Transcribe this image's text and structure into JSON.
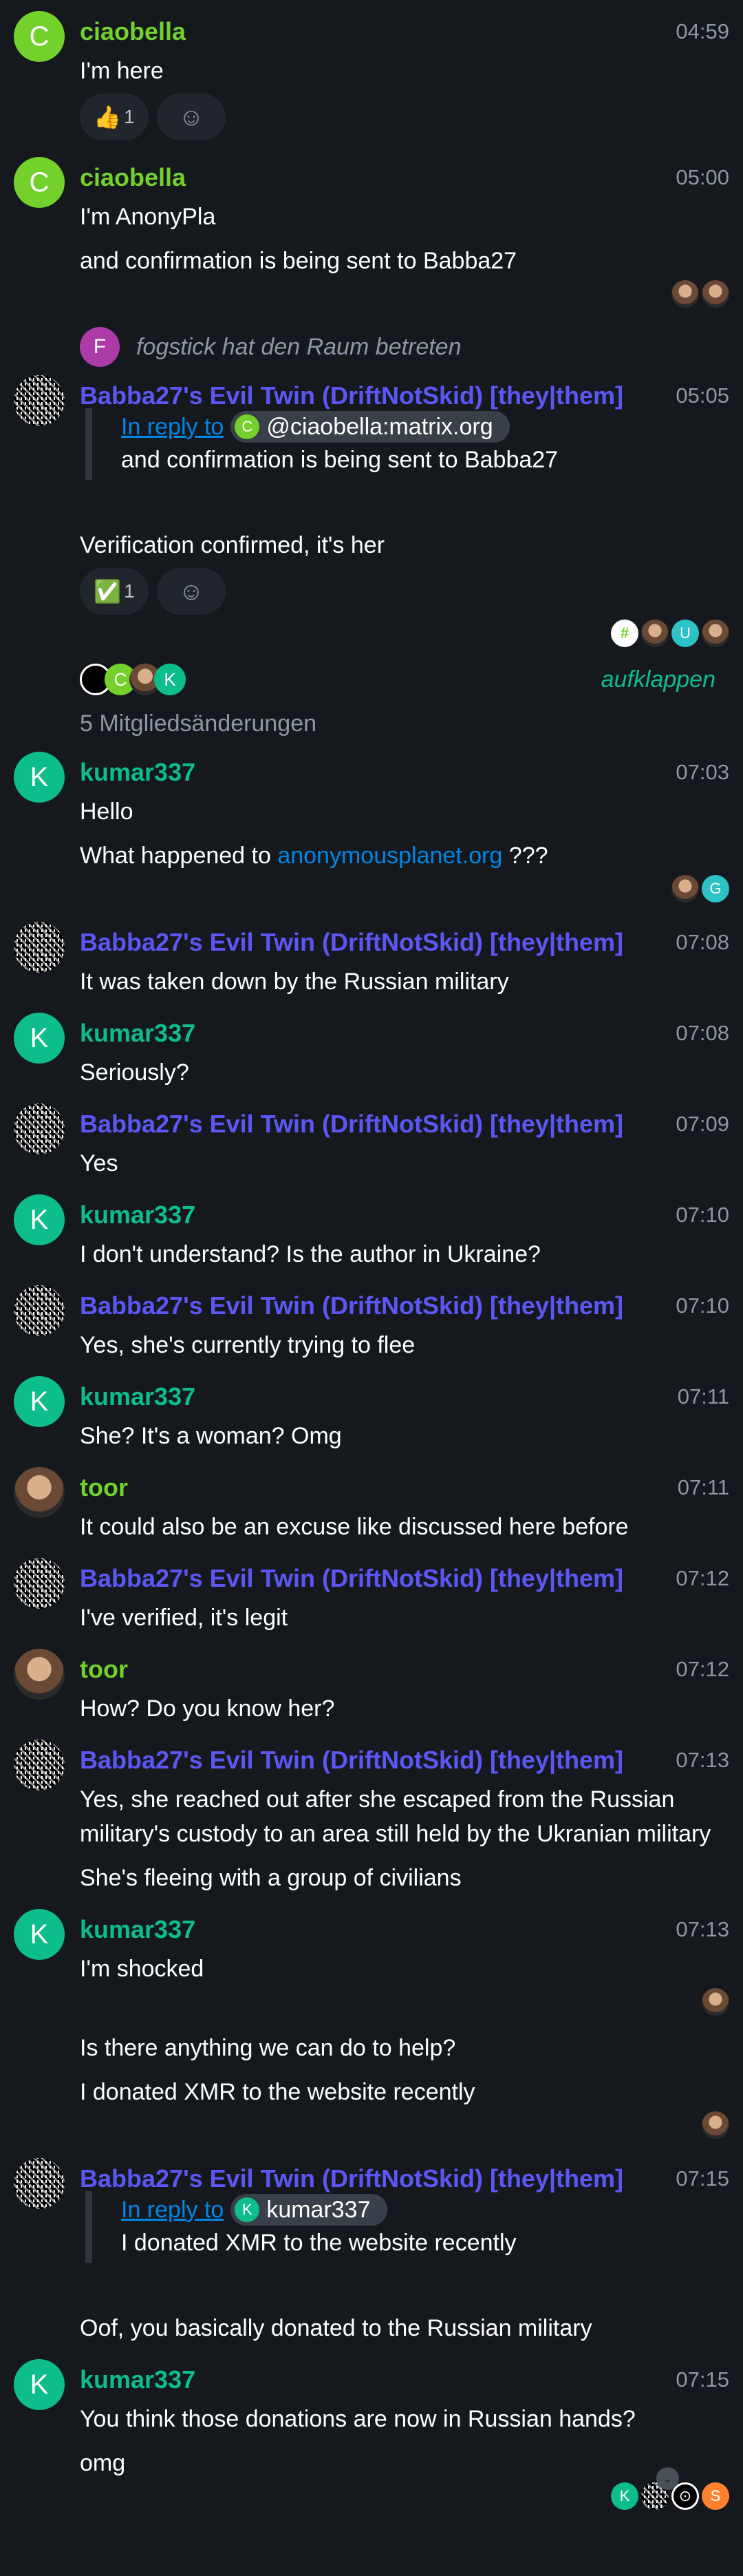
{
  "colors": {
    "ciaobella": "#74d12c",
    "kumar": "#0dbd8b",
    "babba": "#5c56f5",
    "toor": "#74d12c",
    "link": "#0086e6",
    "fogstick": "#ac3ba8",
    "teal": "#2dc2c5",
    "orange": "#ff812d"
  },
  "timeline": [
    {
      "type": "msg",
      "sender": "ciaobella",
      "name_color": "#74d12c",
      "avatar": {
        "kind": "letter",
        "letter": "C",
        "color": "#74d12c"
      },
      "time": "04:59",
      "body": [
        {
          "type": "text",
          "text": "I'm here"
        },
        {
          "type": "reactions",
          "items": [
            {
              "emoji": "👍",
              "count": "1"
            }
          ],
          "add_icon": "add-reaction-icon"
        }
      ]
    },
    {
      "type": "msg",
      "sender": "ciaobella",
      "name_color": "#74d12c",
      "avatar": {
        "kind": "letter",
        "letter": "C",
        "color": "#74d12c"
      },
      "time": "05:00",
      "body": [
        {
          "type": "text",
          "text": "I'm AnonyPla"
        },
        {
          "type": "text",
          "text": "and confirmation is being sent to Babba27"
        },
        {
          "type": "receipts",
          "items": [
            {
              "kind": "photo"
            },
            {
              "kind": "photo"
            }
          ]
        }
      ]
    },
    {
      "type": "event",
      "letter": "F",
      "color": "#ac3ba8",
      "text": "fogstick hat den Raum betreten"
    },
    {
      "type": "msg",
      "sender": "Babba27's Evil Twin (DriftNotSkid) [they|them]",
      "name_color": "#5c56f5",
      "avatar": {
        "kind": "qr"
      },
      "time": "05:05",
      "reply": {
        "label": "In reply to",
        "user": "@ciaobella:matrix.org",
        "user_letter": "C",
        "user_color": "#74d12c",
        "text": "and confirmation is being sent to Babba27"
      },
      "body": [
        {
          "type": "text",
          "text": "Verification confirmed, it's her"
        },
        {
          "type": "reactions",
          "items": [
            {
              "emoji": "✅",
              "count": "1"
            }
          ],
          "add_icon": "add-reaction-icon"
        },
        {
          "type": "receipts",
          "items": [
            {
              "kind": "letter",
              "letter": "#",
              "color": "#ffffff"
            },
            {
              "kind": "photo"
            },
            {
              "kind": "letter",
              "letter": "U",
              "color": "#2dc2c5"
            },
            {
              "kind": "photo"
            }
          ]
        }
      ]
    },
    {
      "type": "summary",
      "avatars": [
        {
          "kind": "letter",
          "letter": "",
          "color": "#000000"
        },
        {
          "kind": "letter",
          "letter": "C",
          "color": "#74d12c"
        },
        {
          "kind": "photo"
        },
        {
          "kind": "letter",
          "letter": "K",
          "color": "#0dbd8b"
        }
      ],
      "expand": "aufklappen",
      "text": "5 Mitgliedsänderungen"
    },
    {
      "type": "msg",
      "sender": "kumar337",
      "name_color": "#0dbd8b",
      "avatar": {
        "kind": "letter",
        "letter": "K",
        "color": "#0dbd8b"
      },
      "time": "07:03",
      "body": [
        {
          "type": "text",
          "text": "Hello"
        },
        {
          "type": "link",
          "before": "What happened to ",
          "link": "anonymousplanet.org",
          "after": " ???"
        },
        {
          "type": "receipts",
          "items": [
            {
              "kind": "photo"
            },
            {
              "kind": "letter",
              "letter": "G",
              "color": "#2dc2c5"
            }
          ]
        }
      ]
    },
    {
      "type": "msg",
      "sender": "Babba27's Evil Twin (DriftNotSkid) [they|them]",
      "name_color": "#5c56f5",
      "avatar": {
        "kind": "qr"
      },
      "time": "07:08",
      "body": [
        {
          "type": "text",
          "text": "It was taken down by the Russian military"
        }
      ]
    },
    {
      "type": "msg",
      "sender": "kumar337",
      "name_color": "#0dbd8b",
      "avatar": {
        "kind": "letter",
        "letter": "K",
        "color": "#0dbd8b"
      },
      "time": "07:08",
      "body": [
        {
          "type": "text",
          "text": "Seriously?"
        }
      ]
    },
    {
      "type": "msg",
      "sender": "Babba27's Evil Twin (DriftNotSkid) [they|them]",
      "name_color": "#5c56f5",
      "avatar": {
        "kind": "qr"
      },
      "time": "07:09",
      "body": [
        {
          "type": "text",
          "text": "Yes"
        }
      ]
    },
    {
      "type": "msg",
      "sender": "kumar337",
      "name_color": "#0dbd8b",
      "avatar": {
        "kind": "letter",
        "letter": "K",
        "color": "#0dbd8b"
      },
      "time": "07:10",
      "body": [
        {
          "type": "text",
          "text": "I don't understand? Is the author in Ukraine?"
        }
      ]
    },
    {
      "type": "msg",
      "sender": "Babba27's Evil Twin (DriftNotSkid) [they|them]",
      "name_color": "#5c56f5",
      "avatar": {
        "kind": "qr"
      },
      "time": "07:10",
      "body": [
        {
          "type": "text",
          "text": "Yes, she's currently trying to flee"
        }
      ]
    },
    {
      "type": "msg",
      "sender": "kumar337",
      "name_color": "#0dbd8b",
      "avatar": {
        "kind": "letter",
        "letter": "K",
        "color": "#0dbd8b"
      },
      "time": "07:11",
      "body": [
        {
          "type": "text",
          "text": "She? It's a woman? Omg"
        }
      ]
    },
    {
      "type": "msg",
      "sender": "toor",
      "name_color": "#74d12c",
      "avatar": {
        "kind": "photo"
      },
      "time": "07:11",
      "body": [
        {
          "type": "text",
          "text": "It could also be an excuse like discussed here before"
        }
      ]
    },
    {
      "type": "msg",
      "sender": "Babba27's Evil Twin (DriftNotSkid) [they|them]",
      "name_color": "#5c56f5",
      "avatar": {
        "kind": "qr"
      },
      "time": "07:12",
      "body": [
        {
          "type": "text",
          "text": "I've verified, it's legit"
        }
      ]
    },
    {
      "type": "msg",
      "sender": "toor",
      "name_color": "#74d12c",
      "avatar": {
        "kind": "photo"
      },
      "time": "07:12",
      "body": [
        {
          "type": "text",
          "text": "How? Do you know her?"
        }
      ]
    },
    {
      "type": "msg",
      "sender": "Babba27's Evil Twin (DriftNotSkid) [they|them]",
      "name_color": "#5c56f5",
      "avatar": {
        "kind": "qr"
      },
      "time": "07:13",
      "body": [
        {
          "type": "text",
          "text": "Yes, she reached out after she escaped from the Russian military's custody to an area still held by the Ukranian military"
        },
        {
          "type": "text",
          "text": "She's fleeing with a group of civilians"
        }
      ]
    },
    {
      "type": "msg",
      "sender": "kumar337",
      "name_color": "#0dbd8b",
      "avatar": {
        "kind": "letter",
        "letter": "K",
        "color": "#0dbd8b"
      },
      "time": "07:13",
      "body": [
        {
          "type": "text",
          "text": "I'm shocked"
        },
        {
          "type": "receipts",
          "items": [
            {
              "kind": "photo"
            }
          ]
        },
        {
          "type": "text",
          "text": "Is there anything we can do to help?"
        },
        {
          "type": "text",
          "text": "I donated XMR to the website recently"
        },
        {
          "type": "receipts",
          "items": [
            {
              "kind": "photo"
            }
          ]
        }
      ]
    },
    {
      "type": "msg",
      "sender": "Babba27's Evil Twin (DriftNotSkid) [they|them]",
      "name_color": "#5c56f5",
      "avatar": {
        "kind": "qr"
      },
      "time": "07:15",
      "reply": {
        "label": "In reply to",
        "user": "kumar337",
        "user_letter": "K",
        "user_color": "#0dbd8b",
        "text": "I donated XMR to the website recently"
      },
      "body": [
        {
          "type": "text",
          "text": "Oof, you basically donated to the Russian military"
        }
      ]
    },
    {
      "type": "msg",
      "sender": "kumar337",
      "name_color": "#0dbd8b",
      "avatar": {
        "kind": "letter",
        "letter": "K",
        "color": "#0dbd8b"
      },
      "time": "07:15",
      "body": [
        {
          "type": "text",
          "text": "You think those donations are now in Russian hands?"
        },
        {
          "type": "text",
          "text": "omg"
        },
        {
          "type": "receipts",
          "items": [
            {
              "kind": "letter",
              "letter": "K",
              "color": "#0dbd8b"
            },
            {
              "kind": "qr"
            },
            {
              "kind": "letter",
              "letter": "⊙",
              "color": "#000000"
            },
            {
              "kind": "letter",
              "letter": "S",
              "color": "#ff812d"
            }
          ]
        }
      ]
    }
  ],
  "scroll_button": {
    "icon": "chevron-down-icon",
    "glyph": "⌄"
  }
}
